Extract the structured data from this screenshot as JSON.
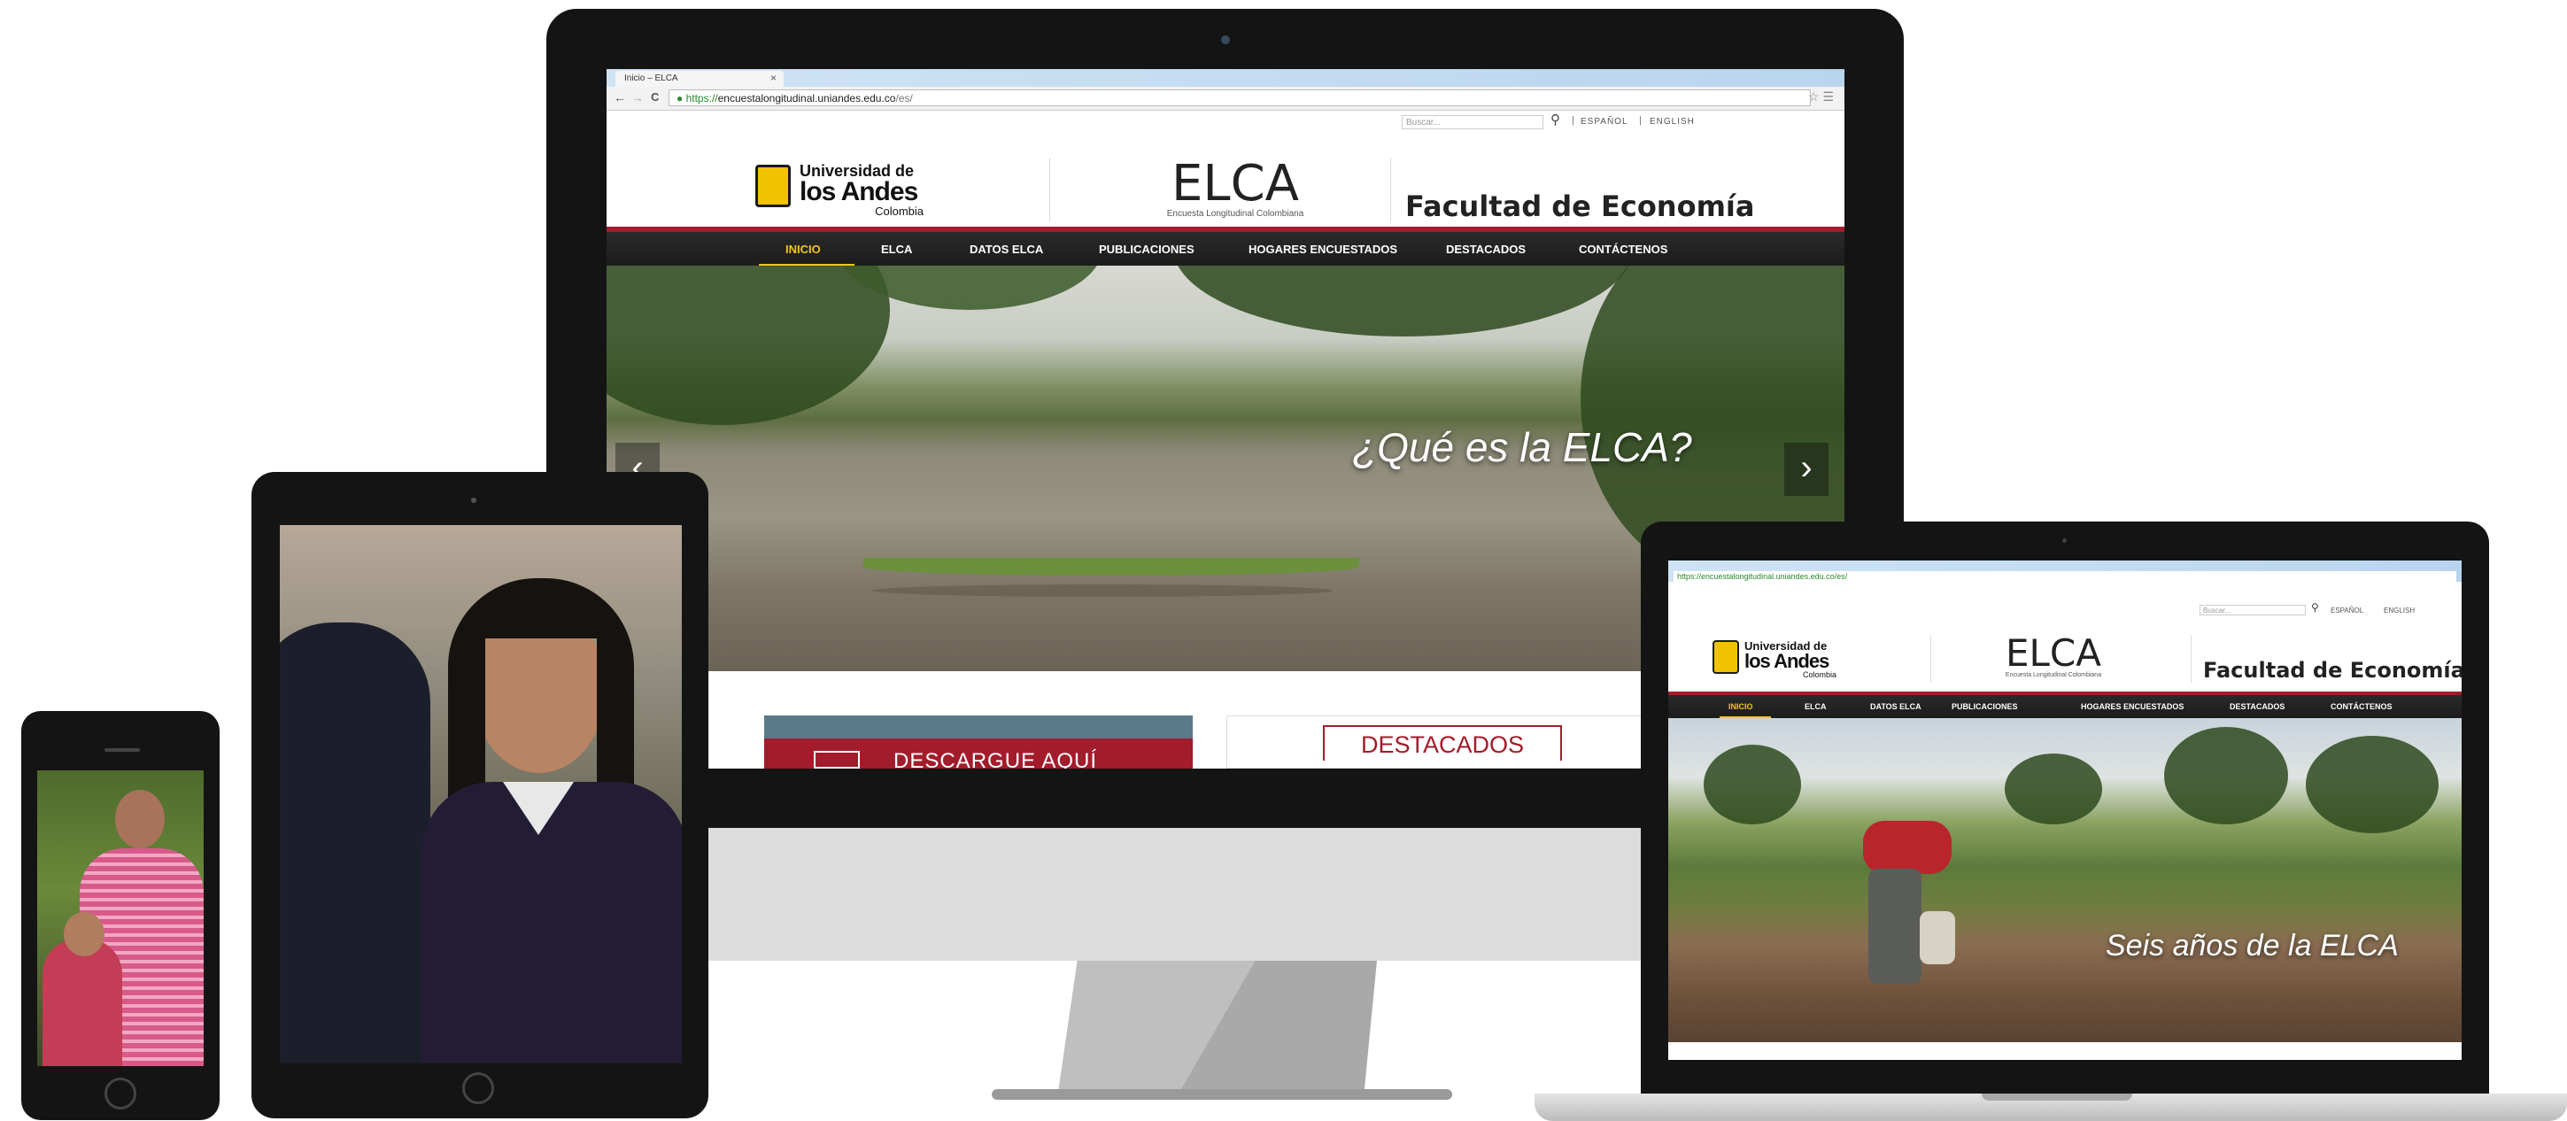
{
  "browser": {
    "tab_title": "Inicio – ELCA",
    "tab_close": "×",
    "url_secure": "https://",
    "url_host": "encuestalongitudinal.uniandes.edu.co",
    "url_path": "/es/",
    "back": "←",
    "forward": "→",
    "reload": "C"
  },
  "site": {
    "search_placeholder": "Buscar...",
    "lang_es": "ESPAÑOL",
    "lang_en": "ENGLISH",
    "separator": "|",
    "uni_line1": "Universidad de",
    "uni_line2": "los Andes",
    "uni_line3": "Colombia",
    "elca_title": "ELCA",
    "elca_subtitle": "Encuesta Longitudinal Colombiana",
    "faculty": "Facultad de Economía",
    "nav": [
      "INICIO",
      "ELCA",
      "DATOS ELCA",
      "PUBLICACIONES",
      "HOGARES ENCUESTADOS",
      "DESTACADOS",
      "CONTÁCTENOS"
    ],
    "slide_caption_desktop": "¿Qué es la ELCA?",
    "slide_caption_laptop": "Seis años de la ELCA",
    "prev_arrow": "‹",
    "next_arrow": "›",
    "download_banner": "DESCARGUE AQUÍ",
    "highlights_heading": "DESTACADOS"
  },
  "laptop_url": "https://encuestalongitudinal.uniandes.edu.co/es/",
  "colors": {
    "nav_bg": "#2a2a2a",
    "accent_red": "#a31c2b",
    "active_yellow": "#f3c51f",
    "device_black": "#141414"
  }
}
